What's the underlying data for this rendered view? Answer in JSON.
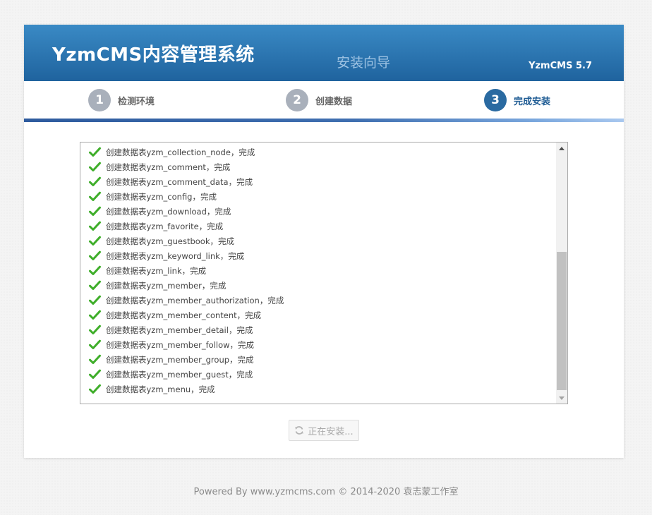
{
  "header": {
    "title": "YzmCMS内容管理系统",
    "wizard_title": "安装向导",
    "version": "YzmCMS 5.7"
  },
  "steps": [
    {
      "number": "1",
      "label": "检测环境",
      "active": false
    },
    {
      "number": "2",
      "label": "创建数据",
      "active": false
    },
    {
      "number": "3",
      "label": "完成安装",
      "active": true
    }
  ],
  "log": {
    "items": [
      "创建数据表yzm_collection_node，完成",
      "创建数据表yzm_comment，完成",
      "创建数据表yzm_comment_data，完成",
      "创建数据表yzm_config，完成",
      "创建数据表yzm_download，完成",
      "创建数据表yzm_favorite，完成",
      "创建数据表yzm_guestbook，完成",
      "创建数据表yzm_keyword_link，完成",
      "创建数据表yzm_link，完成",
      "创建数据表yzm_member，完成",
      "创建数据表yzm_member_authorization，完成",
      "创建数据表yzm_member_content，完成",
      "创建数据表yzm_member_detail，完成",
      "创建数据表yzm_member_follow，完成",
      "创建数据表yzm_member_group，完成",
      "创建数据表yzm_member_guest，完成",
      "创建数据表yzm_menu，完成"
    ],
    "item_icon": "check-icon",
    "scroll_position": 0.42
  },
  "install_button": {
    "label": "正在安装...",
    "icon": "refresh-icon",
    "disabled": true
  },
  "footer": {
    "text": "Powered By www.yzmcms.com © 2014-2020 袁志蒙工作室"
  },
  "colors": {
    "header_top": "#3a8ac5",
    "header_bottom": "#1f639e",
    "active_step": "#2a6aa1",
    "inactive_step": "#a9b0bb",
    "check": "#3fae2a"
  }
}
